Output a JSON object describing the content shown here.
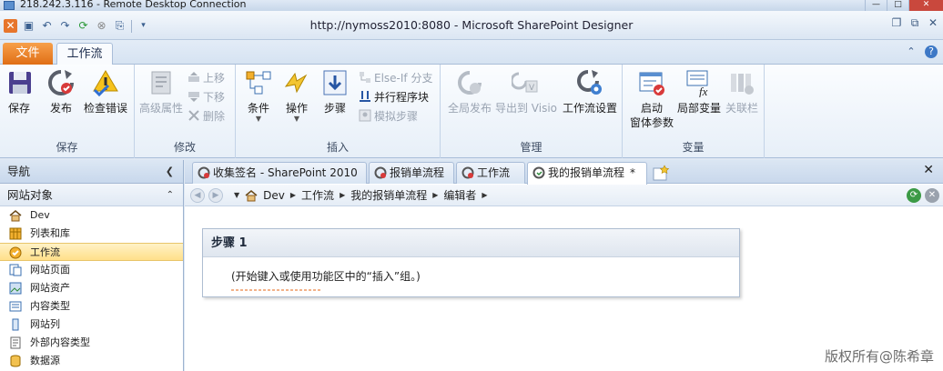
{
  "rdc": {
    "title": "218.242.3.116 - Remote Desktop Connection"
  },
  "window": {
    "title": "http://nymoss2010:8080  -  Microsoft SharePoint Designer"
  },
  "ribbon_tabs": {
    "file": "文件",
    "workflow": "工作流"
  },
  "ribbon": {
    "save": {
      "label": "保存",
      "items": [
        "保存",
        "发布",
        "检查错误"
      ]
    },
    "modify": {
      "label": "修改",
      "advanced": "高级属性",
      "move_up": "上移",
      "move_down": "下移",
      "delete": "删除"
    },
    "insert": {
      "label": "插入",
      "condition": "条件",
      "action": "操作",
      "step": "步骤",
      "else_if": "Else-If 分支",
      "parallel": "并行程序块",
      "impersonation": "模拟步骤"
    },
    "manage": {
      "label": "管理",
      "global_publish": "全局发布",
      "export_visio": "导出到 Visio",
      "workflow_settings": "工作流设置"
    },
    "variables": {
      "label": "变量",
      "init_form_line1": "启动",
      "init_form_line2": "窗体参数",
      "local_vars": "局部变量",
      "association": "关联栏"
    }
  },
  "nav": {
    "header": "导航",
    "section": "网站对象",
    "items": [
      "Dev",
      "列表和库",
      "工作流",
      "网站页面",
      "网站资产",
      "内容类型",
      "网站列",
      "外部内容类型",
      "数据源"
    ],
    "selected_index": 2
  },
  "doc_tabs": [
    "收集签名 - SharePoint 2010",
    "报销单流程",
    "工作流",
    "我的报销单流程"
  ],
  "doc_tab_modified_marker": "*",
  "breadcrumb": [
    "Dev",
    "工作流",
    "我的报销单流程",
    "编辑者"
  ],
  "step": {
    "title": "步骤 1",
    "hint": "(开始键入或使用功能区中的“插入”组。)"
  },
  "watermark": "版权所有@陈希章"
}
